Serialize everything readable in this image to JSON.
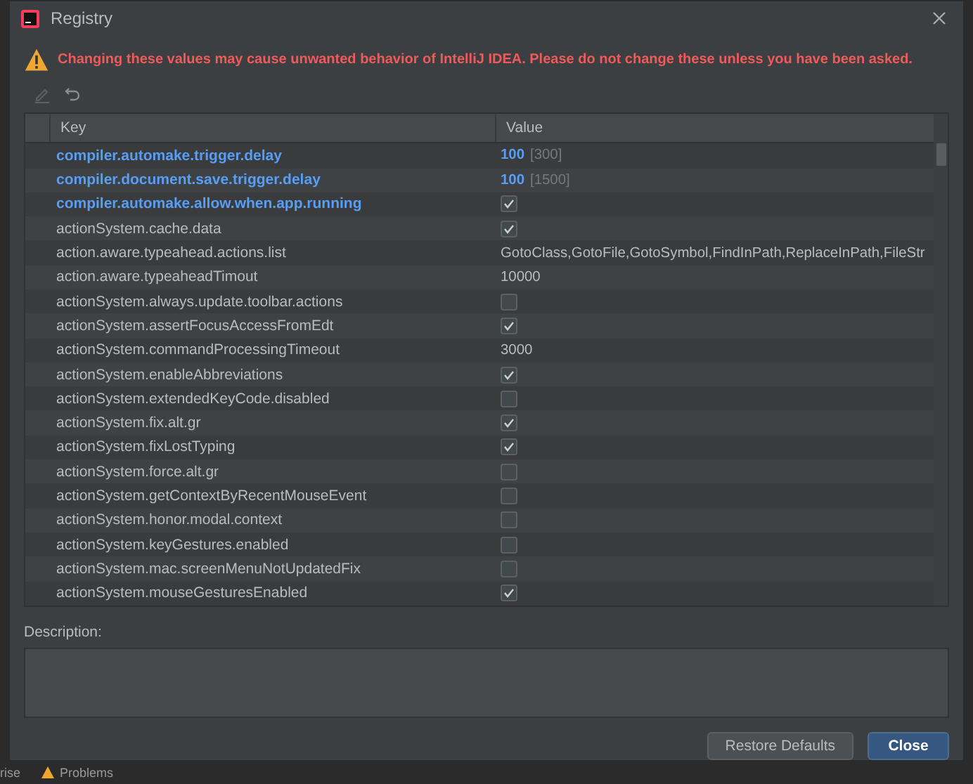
{
  "window": {
    "title": "Registry"
  },
  "warning": "Changing these values may cause unwanted behavior of IntelliJ IDEA. Please do not change these unless you have been asked.",
  "table": {
    "columns": [
      "Key",
      "Value"
    ],
    "rows": [
      {
        "key": "compiler.automake.trigger.delay",
        "modified": true,
        "kind": "number",
        "value": "100",
        "default": "[300]"
      },
      {
        "key": "compiler.document.save.trigger.delay",
        "modified": true,
        "kind": "number",
        "value": "100",
        "default": "[1500]"
      },
      {
        "key": "compiler.automake.allow.when.app.running",
        "modified": true,
        "kind": "checkbox",
        "checked": true
      },
      {
        "key": "actionSystem.cache.data",
        "modified": false,
        "kind": "checkbox",
        "checked": true
      },
      {
        "key": "action.aware.typeahead.actions.list",
        "modified": false,
        "kind": "text",
        "value": "GotoClass,GotoFile,GotoSymbol,FindInPath,ReplaceInPath,FileStr"
      },
      {
        "key": "action.aware.typeaheadTimout",
        "modified": false,
        "kind": "text",
        "value": "10000"
      },
      {
        "key": "actionSystem.always.update.toolbar.actions",
        "modified": false,
        "kind": "checkbox",
        "checked": false
      },
      {
        "key": "actionSystem.assertFocusAccessFromEdt",
        "modified": false,
        "kind": "checkbox",
        "checked": true
      },
      {
        "key": "actionSystem.commandProcessingTimeout",
        "modified": false,
        "kind": "text",
        "value": "3000"
      },
      {
        "key": "actionSystem.enableAbbreviations",
        "modified": false,
        "kind": "checkbox",
        "checked": true
      },
      {
        "key": "actionSystem.extendedKeyCode.disabled",
        "modified": false,
        "kind": "checkbox",
        "checked": false
      },
      {
        "key": "actionSystem.fix.alt.gr",
        "modified": false,
        "kind": "checkbox",
        "checked": true
      },
      {
        "key": "actionSystem.fixLostTyping",
        "modified": false,
        "kind": "checkbox",
        "checked": true
      },
      {
        "key": "actionSystem.force.alt.gr",
        "modified": false,
        "kind": "checkbox",
        "checked": false
      },
      {
        "key": "actionSystem.getContextByRecentMouseEvent",
        "modified": false,
        "kind": "checkbox",
        "checked": false
      },
      {
        "key": "actionSystem.honor.modal.context",
        "modified": false,
        "kind": "checkbox",
        "checked": false
      },
      {
        "key": "actionSystem.keyGestures.enabled",
        "modified": false,
        "kind": "checkbox",
        "checked": false
      },
      {
        "key": "actionSystem.mac.screenMenuNotUpdatedFix",
        "modified": false,
        "kind": "checkbox",
        "checked": false
      },
      {
        "key": "actionSystem.mouseGesturesEnabled",
        "modified": false,
        "kind": "checkbox",
        "checked": true
      }
    ]
  },
  "description": {
    "label": "Description:"
  },
  "buttons": [
    {
      "label": "Restore Defaults",
      "primary": false
    },
    {
      "label": "Close",
      "primary": true
    }
  ],
  "status_bar": [
    {
      "label": "rise",
      "kind": "text"
    },
    {
      "label": "Problems",
      "kind": "warning"
    }
  ]
}
